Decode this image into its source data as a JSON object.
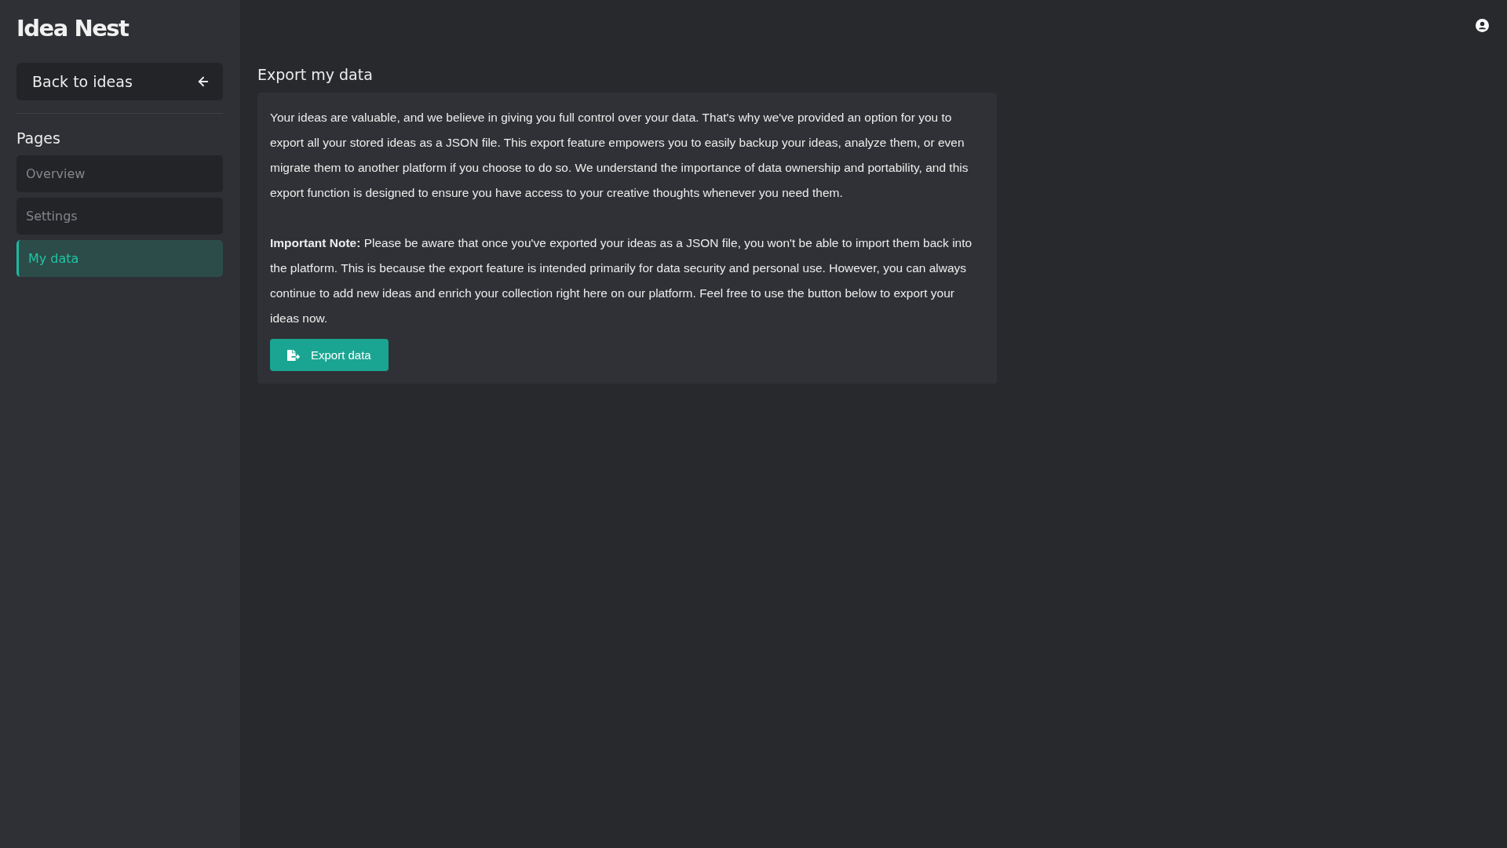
{
  "sidebar": {
    "logo": "Idea Nest",
    "back_button": "Back to ideas",
    "section_title": "Pages",
    "items": [
      {
        "label": "Overview",
        "selected": false
      },
      {
        "label": "Settings",
        "selected": false
      },
      {
        "label": "My data",
        "selected": true
      }
    ]
  },
  "main": {
    "title": "Export my data",
    "paragraphs": [
      "Your ideas are valuable, and we believe in giving you full control over your data. That's why we've provided an option for you to export all your stored ideas as a JSON file. This export feature empowers you to easily backup your ideas, analyze them, or even migrate them to another platform if you choose to do so. We understand the importance of data ownership and portability, and this export function is designed to ensure you have access to your creative thoughts whenever you need them.",
      "**Important Note:** Please be aware that once you've exported your ideas as a JSON file, you won't be able to import them back into the platform. This is because the export feature is intended primarily for data security and personal use. However, you can always continue to add new ideas and enrich your collection right here on our platform. Feel free to use the button below to export your ideas now."
    ],
    "export_button": "Export data"
  }
}
